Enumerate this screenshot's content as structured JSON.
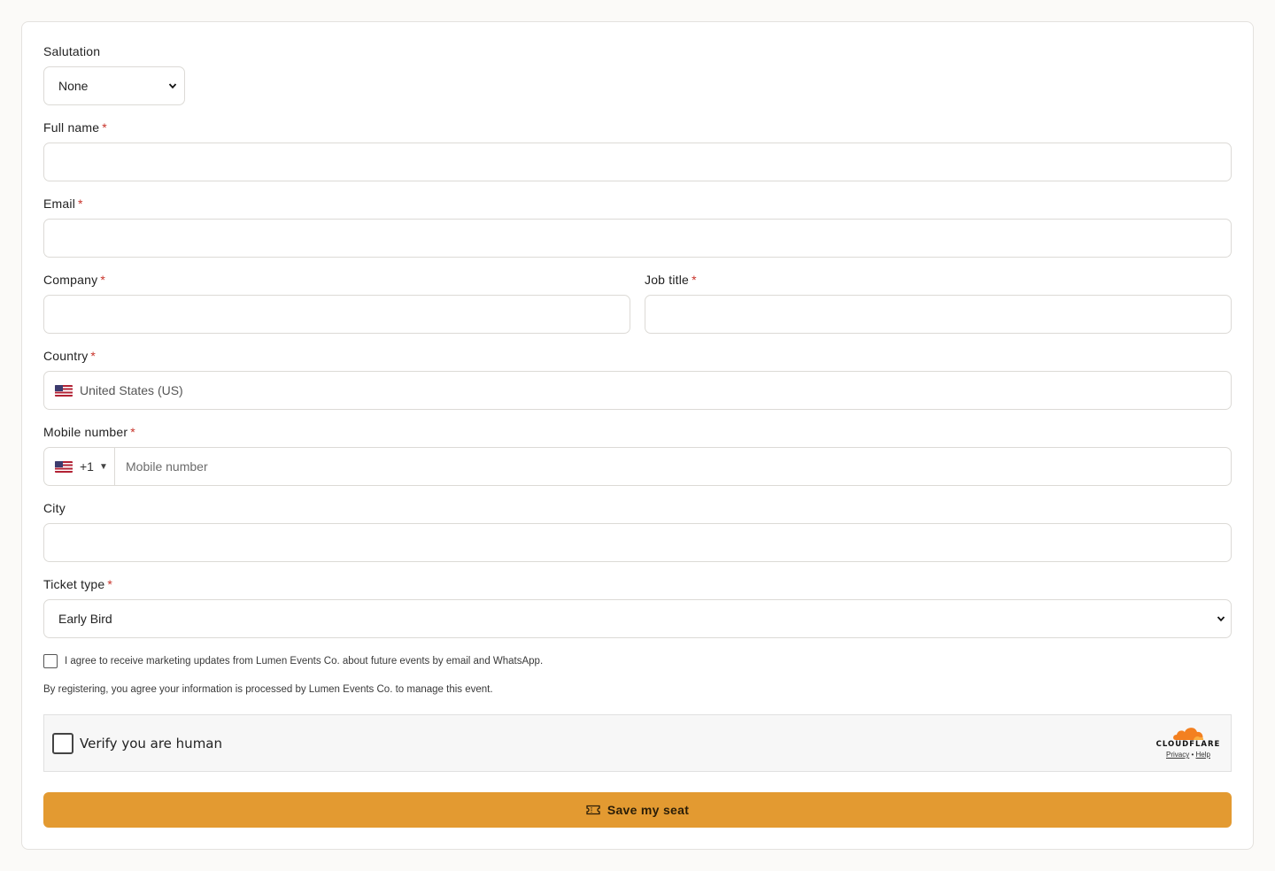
{
  "form": {
    "salutation": {
      "label": "Salutation",
      "value": "None"
    },
    "full_name": {
      "label": "Full name",
      "required": "*"
    },
    "email": {
      "label": "Email",
      "required": "*"
    },
    "company": {
      "label": "Company",
      "required": "*"
    },
    "job_title": {
      "label": "Job title",
      "required": "*"
    },
    "country": {
      "label": "Country",
      "required": "*",
      "value": "United States (US)",
      "flag_icon": "us-flag-icon"
    },
    "mobile": {
      "label": "Mobile number",
      "required": "*",
      "dial_code": "+1",
      "placeholder": "Mobile number"
    },
    "city": {
      "label": "City"
    },
    "ticket_type": {
      "label": "Ticket type",
      "required": "*",
      "value": "Early Bird"
    },
    "consent_text": "I agree to receive marketing updates from Lumen Events Co. about future events by email and WhatsApp.",
    "notice_text": "By registering, you agree your information is processed by Lumen Events Co. to manage this event.",
    "captcha": {
      "label": "Verify you are human",
      "brand": "CLOUDFLARE",
      "privacy": "Privacy",
      "separator": "•",
      "help": "Help"
    },
    "submit_label": "Save my seat"
  },
  "colors": {
    "accent": "#e39a31",
    "required": "#c8332a",
    "cloudflare_orange": "#f38020"
  }
}
